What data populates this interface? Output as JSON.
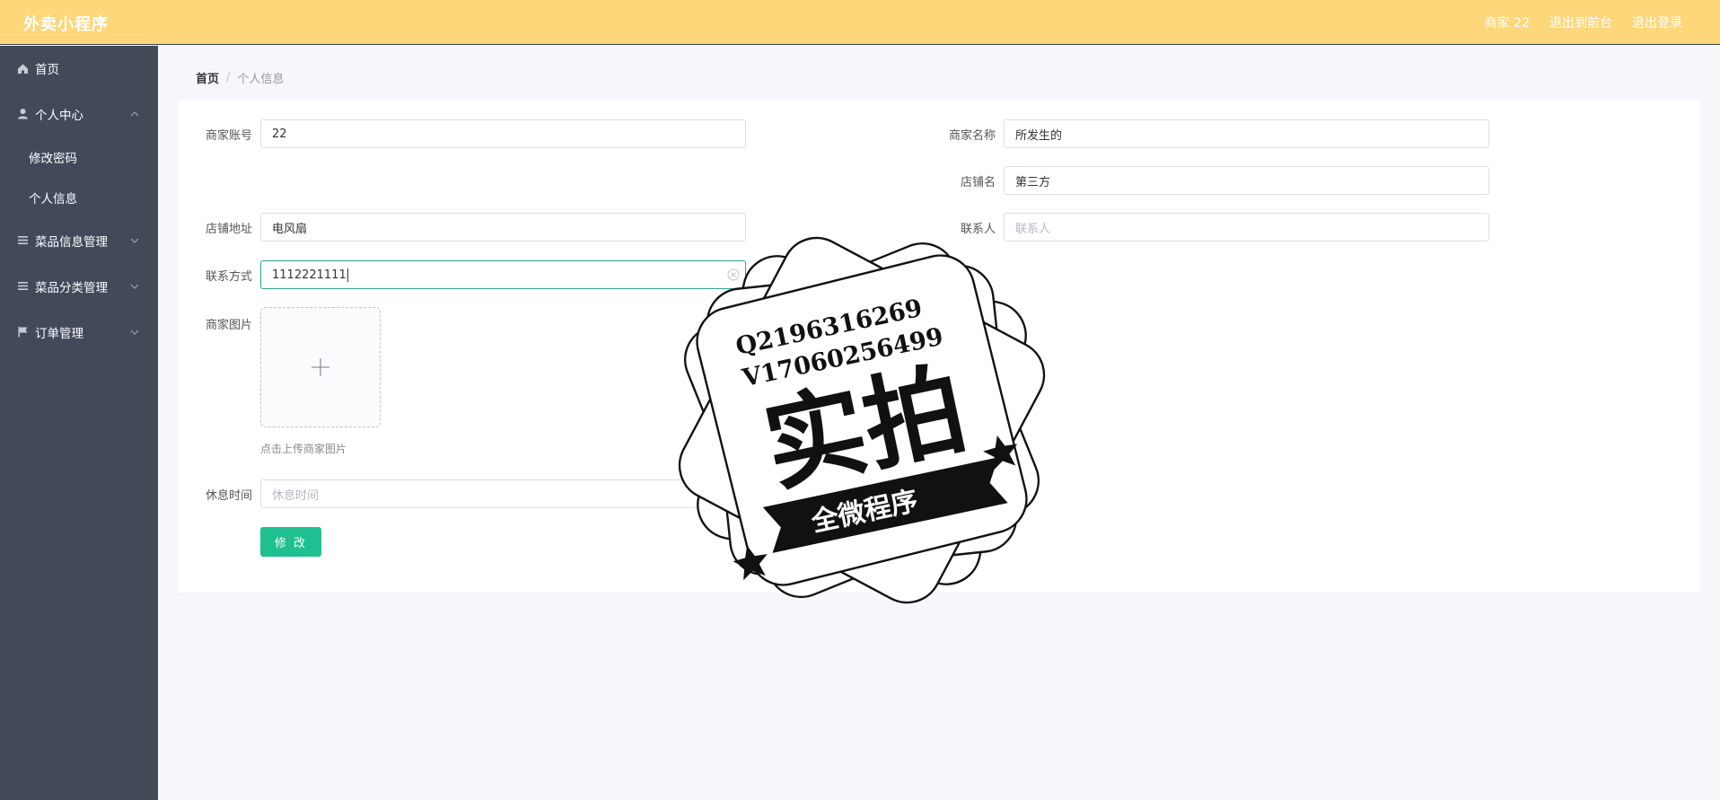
{
  "header": {
    "app_title": "外卖小程序",
    "user_label": "商家 22",
    "back_to_front": "退出到前台",
    "logout": "退出登录"
  },
  "sidebar": {
    "items": [
      {
        "label": "首页",
        "icon": "home-icon"
      },
      {
        "label": "个人中心",
        "icon": "user-icon",
        "expanded": true
      },
      {
        "label": "修改密码"
      },
      {
        "label": "个人信息"
      },
      {
        "label": "菜品信息管理",
        "icon": "list-icon"
      },
      {
        "label": "菜品分类管理",
        "icon": "list-icon"
      },
      {
        "label": "订单管理",
        "icon": "flag-icon"
      }
    ]
  },
  "breadcrumb": {
    "home": "首页",
    "separator": "/",
    "current": "个人信息"
  },
  "form": {
    "merchant_account": {
      "label": "商家账号",
      "value": "22"
    },
    "merchant_name": {
      "label": "商家名称",
      "value": "所发生的"
    },
    "shop_name": {
      "label": "店铺名",
      "value": "第三方"
    },
    "shop_address": {
      "label": "店铺地址",
      "value": "电风扇"
    },
    "contact_person": {
      "label": "联系人",
      "placeholder": "联系人"
    },
    "contact_phone": {
      "label": "联系方式",
      "value": "1112221111"
    },
    "merchant_image": {
      "label": "商家图片",
      "hint": "点击上传商家图片"
    },
    "rest_time": {
      "label": "休息时间",
      "placeholder": "休息时间"
    },
    "submit_label": "修 改"
  },
  "watermark": {
    "line1": "Q2196316269",
    "line2": "V17060256499",
    "big_text": "实拍",
    "banner_text": "全微程序"
  },
  "colors": {
    "header_bg": "#fed77a",
    "sidebar_bg": "#424a5a",
    "accent": "#1fbf90"
  }
}
